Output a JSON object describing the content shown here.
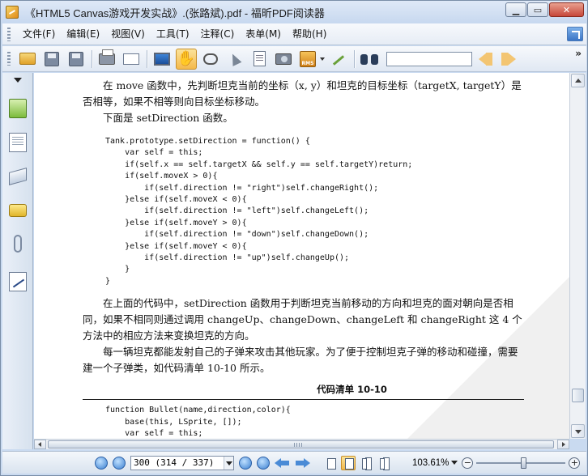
{
  "window": {
    "title": "《HTML5 Canvas游戏开发实战》.(张路斌).pdf - 福昕PDF阅读器"
  },
  "menu": {
    "items": [
      "文件(F)",
      "编辑(E)",
      "视图(V)",
      "工具(T)",
      "注释(C)",
      "表单(M)",
      "帮助(H)"
    ]
  },
  "toolbar": {
    "icons": [
      "open-folder-icon",
      "save-icon",
      "save-as-icon",
      "print-icon",
      "email-icon",
      "fullscreen-icon",
      "hand-tool-icon",
      "loupe-icon",
      "select-arrow-icon",
      "text-select-icon",
      "snapshot-icon",
      "rms-icon",
      "sign-icon",
      "find-binoculars-icon"
    ],
    "rms_label": "RMS",
    "search_value": "",
    "overflow_label": "»"
  },
  "document": {
    "para1": "在 move 函数中，先判断坦克当前的坐标（x, y）和坦克的目标坐标（targetX, targetY）是否相等，如果不相等则向目标坐标移动。",
    "para2": "下面是 setDirection 函数。",
    "code1": "Tank.prototype.setDirection = function() {\n    var self = this;\n    if(self.x == self.targetX && self.y == self.targetY)return;\n    if(self.moveX > 0){\n        if(self.direction != \"right\")self.changeRight();\n    }else if(self.moveX < 0){\n        if(self.direction != \"left\")self.changeLeft();\n    }else if(self.moveY > 0){\n        if(self.direction != \"down\")self.changeDown();\n    }else if(self.moveY < 0){\n        if(self.direction != \"up\")self.changeUp();\n    }\n}",
    "para3": "在上面的代码中，setDirection 函数用于判断坦克当前移动的方向和坦克的面对朝向是否相同，如果不相同则通过调用 changeUp、changeDown、changeLeft 和 changeRight 这 4 个方法中的相应方法来变换坦克的方向。",
    "para4": "每一辆坦克都能发射自己的子弹来攻击其他玩家。为了便于控制坦克子弹的移动和碰撞，需要建一个子弹类，如代码清单 10-10 所示。",
    "caption": "代码清单   10-10",
    "code2": "function Bullet(name,direction,color){\n    base(this, LSprite, []);\n    var self = this;"
  },
  "statusbar": {
    "page_value": "300 (314 / 337)",
    "zoom_value": "103.61%",
    "zoom_out_label": "−",
    "zoom_in_label": "+"
  },
  "colors": {
    "frame": "#c9daf0",
    "toolbar_bg": "#e6ecf5",
    "active_tool": "#f4b94b",
    "close_button": "#c6473a"
  }
}
